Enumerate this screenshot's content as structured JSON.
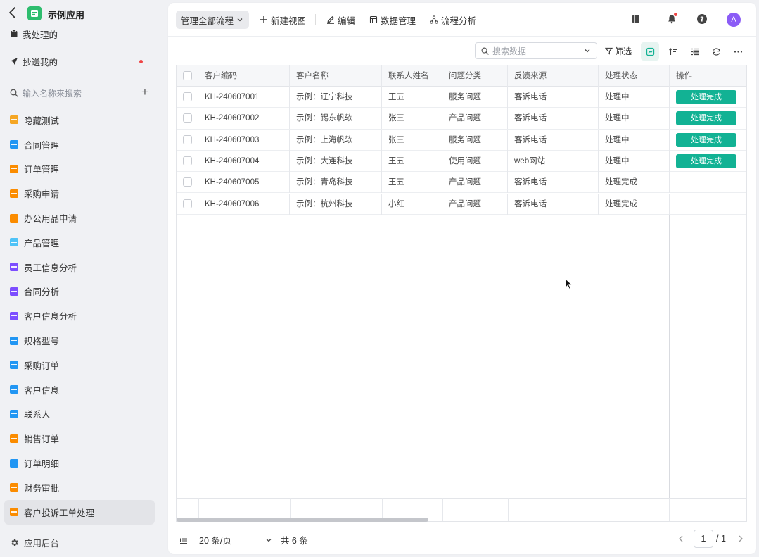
{
  "app": {
    "title": "示例应用"
  },
  "sidebar": {
    "fixed": [
      {
        "label": "我处理的",
        "icon": "inbox-icon"
      },
      {
        "label": "抄送我的",
        "icon": "send-icon"
      }
    ],
    "search_placeholder": "输入名称来搜索",
    "items": [
      {
        "label": "隐藏测试",
        "color": "#f5a623"
      },
      {
        "label": "合同管理",
        "color": "#2196f3"
      },
      {
        "label": "订单管理",
        "color": "#fb8c00"
      },
      {
        "label": "采购申请",
        "color": "#fb8c00"
      },
      {
        "label": "办公用品申请",
        "color": "#fb8c00"
      },
      {
        "label": "产品管理",
        "color": "#4fc3f7"
      },
      {
        "label": "员工信息分析",
        "color": "#7c4dff"
      },
      {
        "label": "合同分析",
        "color": "#7c4dff"
      },
      {
        "label": "客户信息分析",
        "color": "#7c4dff"
      },
      {
        "label": "规格型号",
        "color": "#2196f3"
      },
      {
        "label": "采购订单",
        "color": "#2196f3"
      },
      {
        "label": "客户信息",
        "color": "#2196f3"
      },
      {
        "label": "联系人",
        "color": "#2196f3"
      },
      {
        "label": "销售订单",
        "color": "#fb8c00"
      },
      {
        "label": "订单明细",
        "color": "#2196f3"
      },
      {
        "label": "财务审批",
        "color": "#fb8c00"
      },
      {
        "label": "客户投诉工单处理",
        "color": "#fb8c00"
      }
    ],
    "admin_label": "应用后台"
  },
  "toolbar": {
    "view_select": "管理全部流程",
    "new_view": "新建视图",
    "edit": "编辑",
    "data_manage": "数据管理",
    "flow_analysis": "流程分析",
    "avatar_letter": "A"
  },
  "controls": {
    "search_placeholder": "搜索数据",
    "filter_label": "筛选"
  },
  "table": {
    "columns": [
      "客户编码",
      "客户名称",
      "联系人姓名",
      "问题分类",
      "反馈来源",
      "处理状态",
      "操作"
    ],
    "rows": [
      {
        "code": "KH-240607001",
        "name": "示例：辽宁科技",
        "contact": "王五",
        "category": "服务问题",
        "source": "客诉电话",
        "status": "处理中",
        "action": "处理完成"
      },
      {
        "code": "KH-240607002",
        "name": "示例：锡东帆软",
        "contact": "张三",
        "category": "产品问题",
        "source": "客诉电话",
        "status": "处理中",
        "action": "处理完成"
      },
      {
        "code": "KH-240607003",
        "name": "示例：上海帆软",
        "contact": "张三",
        "category": "服务问题",
        "source": "客诉电话",
        "status": "处理中",
        "action": "处理完成"
      },
      {
        "code": "KH-240607004",
        "name": "示例：大连科技",
        "contact": "王五",
        "category": "使用问题",
        "source": "web网站",
        "status": "处理中",
        "action": "处理完成"
      },
      {
        "code": "KH-240607005",
        "name": "示例：青岛科技",
        "contact": "王五",
        "category": "产品问题",
        "source": "客诉电话",
        "status": "处理完成",
        "action": ""
      },
      {
        "code": "KH-240607006",
        "name": "示例：杭州科技",
        "contact": "小红",
        "category": "产品问题",
        "source": "客诉电话",
        "status": "处理完成",
        "action": ""
      }
    ]
  },
  "footer": {
    "page_size": "20 条/页",
    "total": "共 6 条",
    "current_page": "1",
    "page_count": "/ 1"
  }
}
